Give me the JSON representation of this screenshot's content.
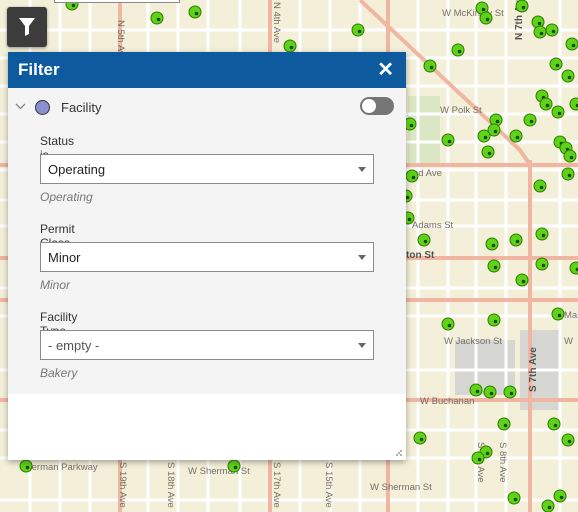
{
  "map": {
    "streets": {
      "w_mckinley": "W McKinley St",
      "n_4th": "N 4th Ave",
      "n_5th": "N 5th Ave",
      "w_polk": "W Polk St",
      "n_7th": "N 7th Ave",
      "ad_ave": "ad Ave",
      "w_adams": "Adams St",
      "w_washington": "ton St",
      "w_jackson": "W Jackson St",
      "s_7th": "S 7th Ave",
      "w_buchanan": "W Buchanan",
      "w_sherman": "W Sherman St",
      "w_sherman2": "W Sherman St",
      "s_19th": "S 19th Ave",
      "s_18th": "S 18th Ave",
      "s_17th": "S 17th Ave",
      "s_15th": "S 15th Ave",
      "s_9th": "S 9th Ave",
      "s_8th": "S 8th Ave",
      "sherman_parkway": "Sherman Parkway",
      "mac": "Mac",
      "w_mac": "W"
    }
  },
  "filter_panel": {
    "title": "Filter",
    "close_icon": "close-icon",
    "layer": {
      "name": "Facility",
      "color": "#8a8fd0",
      "enabled": false
    },
    "expressions": [
      {
        "label": "Status is",
        "value": "Operating",
        "hint": "Operating",
        "is_placeholder": false
      },
      {
        "label": "Permit Class is",
        "value": "Minor",
        "hint": "Minor",
        "is_placeholder": false
      },
      {
        "label": "Facility Type is",
        "value": "- empty -",
        "hint": "Bakery",
        "is_placeholder": true
      }
    ]
  },
  "colors": {
    "header": "#0d5a9e",
    "marker": "#5fd319",
    "map_bg": "#f3efd9",
    "highway": "#f2b8a7"
  }
}
